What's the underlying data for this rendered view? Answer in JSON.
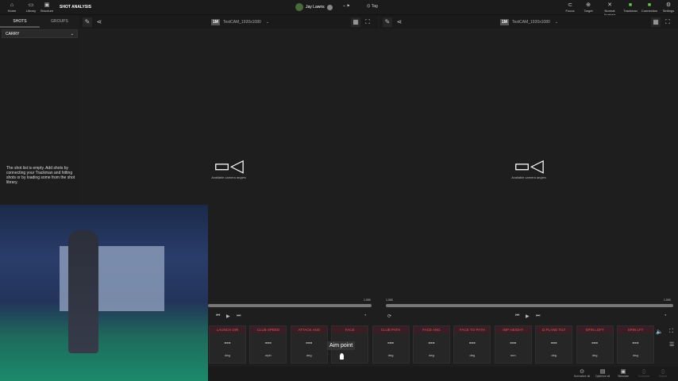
{
  "topbar": {
    "left": [
      {
        "label": "Home",
        "icon": "home-icon",
        "g": "⌂"
      },
      {
        "label": "Library",
        "icon": "folder-icon",
        "g": "▭"
      },
      {
        "label": "Structure",
        "icon": "monitor-icon",
        "g": "▣"
      }
    ],
    "title": "SHOT ANALYSIS",
    "user": "Jay Lawns",
    "tag": "Tag",
    "right": [
      {
        "label": "Focus",
        "icon": "focus-icon",
        "g": "⊂"
      },
      {
        "label": "Target",
        "icon": "target-icon",
        "g": "⊕"
      },
      {
        "label": "Normal Analysis",
        "icon": "analysis-icon",
        "g": "✕"
      },
      {
        "label": "Trackman",
        "icon": "trackman-icon",
        "g": "■"
      },
      {
        "label": "Connection",
        "icon": "connection-icon",
        "g": "■"
      },
      {
        "label": "Settings",
        "icon": "gear-icon",
        "g": "⚙"
      }
    ]
  },
  "sidebar": {
    "tabs": [
      "SHOTS",
      "GROUPS"
    ],
    "dropdown": "CARRY",
    "empty": "The shot list is empty. Add shots by connecting your Trackman and hitting shots or by loading some from the shot library."
  },
  "panels": [
    {
      "badge": "1M",
      "camera": "TestCAM_1920x1080",
      "message": "Available camera angles",
      "time_end": "1.000",
      "time_start": ""
    },
    {
      "badge": "1M",
      "camera": "TestCAM_1920x1080",
      "message": "Available camera angles",
      "time_start": "1.000",
      "time_end": "1.000"
    }
  ],
  "params": [
    {
      "name": "LAUNCH DIR",
      "value": "---",
      "unit": "deg"
    },
    {
      "name": "CLUB SPEED",
      "value": "---",
      "unit": "mph"
    },
    {
      "name": "ATTACK ANG",
      "value": "---",
      "unit": "deg"
    },
    {
      "name": "FACE",
      "value": "---",
      "unit": ""
    },
    {
      "name": "CLUB PATH",
      "value": "---",
      "unit": "deg"
    },
    {
      "name": "FACE ANG",
      "value": "---",
      "unit": "deg"
    },
    {
      "name": "FACE TO PATH",
      "value": "---",
      "unit": "deg"
    },
    {
      "name": "IMP HEIGHT",
      "value": "---",
      "unit": "mm"
    },
    {
      "name": "D.PLANE TILT",
      "value": "---",
      "unit": "deg"
    },
    {
      "name": "SPIN LOFT",
      "value": "---",
      "unit": "deg"
    },
    {
      "name": "SPIN LFT",
      "value": "---",
      "unit": "deg"
    }
  ],
  "aim_point": "Aim point",
  "bottom": [
    {
      "label": "Normalize all",
      "g": "⊙"
    },
    {
      "label": "Optimize all",
      "g": "▤"
    },
    {
      "label": "Simulate",
      "g": "▣"
    },
    {
      "label": "Compare",
      "g": "▯"
    },
    {
      "label": "Export",
      "g": "▯"
    }
  ]
}
